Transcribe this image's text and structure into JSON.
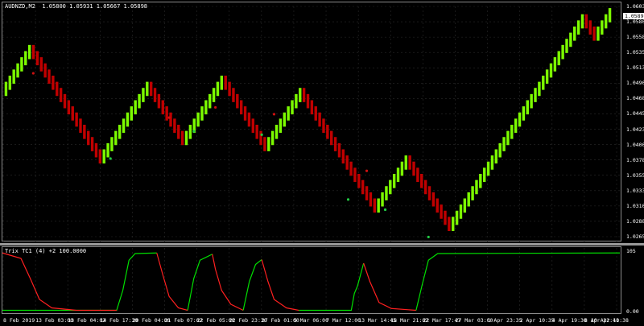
{
  "header": {
    "symbol_tf": "AUDNZD,M2",
    "ohlc": "1.05800 1.05931 1.05667 1.05898",
    "indicator": "Trix TC1 (4) +2 100.0000"
  },
  "price_axis": [
    "1.06030",
    "1.05805",
    "1.05580",
    "1.05355",
    "1.05130",
    "1.04905",
    "1.04680",
    "1.04455",
    "1.04230",
    "1.04005",
    "1.03780",
    "1.03555",
    "1.03330",
    "1.03105",
    "1.02880",
    "1.02655"
  ],
  "current_price": "1.05898",
  "indicator_axis": [
    "105",
    "0.00"
  ],
  "time_axis": [
    "8 Feb 2019",
    "13 Feb 03:00",
    "13 Feb 04:02",
    "14 Feb 17:30",
    "20 Feb 04:06",
    "21 Feb 07:02",
    "22 Feb 05:00",
    "22 Feb 23:36",
    "27 Feb 01:00",
    "5 Mar 06:00",
    "7 Mar 12:00",
    "13 Mar 14:45",
    "18 Mar 21:02",
    "22 Mar 17:47",
    "27 Mar 03:00",
    "1 Apr 23:35",
    "2 Apr 10:35",
    "4 Apr 19:30",
    "8 Apr 22:41",
    "10 Apr 10:38"
  ],
  "colors": {
    "up": "#7cfc00",
    "down": "#c00000",
    "grid": "#2a2a2a",
    "trix_up": "#00e000",
    "trix_down": "#ff2020"
  },
  "chart_data": {
    "type": "renko",
    "price_path": [
      1.048,
      1.053,
      1.0545,
      1.049,
      1.044,
      1.0405,
      1.0385,
      1.043,
      1.046,
      1.049,
      1.045,
      1.041,
      1.0445,
      1.05,
      1.0455,
      1.042,
      1.0395,
      1.044,
      1.048,
      1.0435,
      1.036,
      1.034,
      1.031,
      1.036,
      1.0385,
      1.0345,
      1.0305,
      1.0285,
      1.0315,
      1.038,
      1.044,
      1.05,
      1.055,
      1.059,
      1.056,
      1.06
    ],
    "dots_green": [
      [
        0.175,
        1.038
      ],
      [
        0.31,
        1.042
      ],
      [
        0.42,
        1.0415
      ],
      [
        0.56,
        1.032
      ],
      [
        0.62,
        1.0305
      ],
      [
        0.69,
        1.0265
      ]
    ],
    "dots_red": [
      [
        0.05,
        1.0505
      ],
      [
        0.27,
        1.044
      ],
      [
        0.345,
        1.0455
      ],
      [
        0.44,
        1.0445
      ],
      [
        0.59,
        1.0362
      ]
    ],
    "trix_segments": [
      {
        "color": "trix_up",
        "points": [
          [
            0.0,
            0.02
          ],
          [
            0.185,
            0.02
          ],
          [
            0.195,
            0.35
          ],
          [
            0.205,
            0.85
          ],
          [
            0.215,
            0.96
          ],
          [
            0.25,
            0.97
          ]
        ]
      },
      {
        "color": "trix_down",
        "points": [
          [
            0.0,
            0.97
          ],
          [
            0.03,
            0.88
          ],
          [
            0.045,
            0.55
          ],
          [
            0.06,
            0.2
          ],
          [
            0.08,
            0.06
          ],
          [
            0.12,
            0.02
          ],
          [
            0.185,
            0.02
          ]
        ]
      },
      {
        "color": "trix_down",
        "points": [
          [
            0.25,
            0.97
          ],
          [
            0.26,
            0.6
          ],
          [
            0.27,
            0.25
          ],
          [
            0.285,
            0.06
          ],
          [
            0.3,
            0.02
          ]
        ]
      },
      {
        "color": "trix_up",
        "points": [
          [
            0.3,
            0.02
          ],
          [
            0.31,
            0.55
          ],
          [
            0.32,
            0.85
          ],
          [
            0.34,
            0.95
          ]
        ]
      },
      {
        "color": "trix_down",
        "points": [
          [
            0.34,
            0.95
          ],
          [
            0.345,
            0.7
          ],
          [
            0.355,
            0.35
          ],
          [
            0.37,
            0.12
          ],
          [
            0.39,
            0.02
          ]
        ]
      },
      {
        "color": "trix_up",
        "points": [
          [
            0.39,
            0.02
          ],
          [
            0.4,
            0.5
          ],
          [
            0.41,
            0.78
          ],
          [
            0.42,
            0.86
          ]
        ]
      },
      {
        "color": "trix_down",
        "points": [
          [
            0.42,
            0.86
          ],
          [
            0.43,
            0.5
          ],
          [
            0.44,
            0.2
          ],
          [
            0.46,
            0.06
          ],
          [
            0.48,
            0.02
          ]
        ]
      },
      {
        "color": "trix_up",
        "points": [
          [
            0.48,
            0.02
          ],
          [
            0.565,
            0.02
          ],
          [
            0.57,
            0.3
          ],
          [
            0.575,
            0.42
          ],
          [
            0.585,
            0.8
          ]
        ]
      },
      {
        "color": "trix_down",
        "points": [
          [
            0.585,
            0.8
          ],
          [
            0.595,
            0.5
          ],
          [
            0.61,
            0.15
          ],
          [
            0.63,
            0.05
          ],
          [
            0.67,
            0.02
          ]
        ]
      },
      {
        "color": "trix_up",
        "points": [
          [
            0.67,
            0.02
          ],
          [
            0.68,
            0.45
          ],
          [
            0.69,
            0.85
          ],
          [
            0.705,
            0.96
          ],
          [
            1.0,
            0.97
          ]
        ]
      }
    ]
  }
}
